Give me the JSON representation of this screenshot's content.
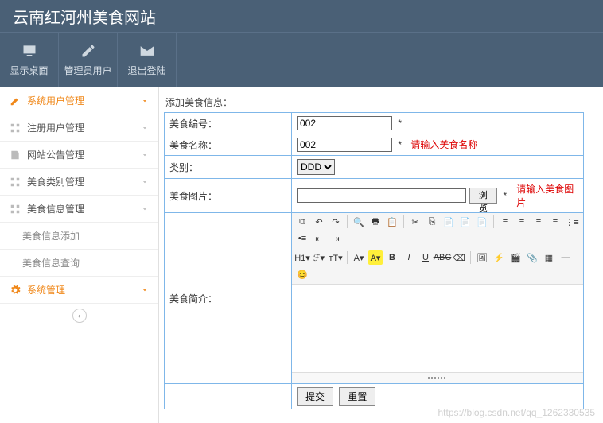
{
  "header": {
    "title": "云南红河州美食网站"
  },
  "toolbar": {
    "desktop": "显示桌面",
    "admin": "管理员用户",
    "logout": "退出登陆"
  },
  "sidebar": {
    "sys_user": "系统用户管理",
    "reg_user": "注册用户管理",
    "notice": "网站公告管理",
    "food_cat": "美食类别管理",
    "food_info": "美食信息管理",
    "food_add": "美食信息添加",
    "food_query": "美食信息查询",
    "sys_mgr": "系统管理"
  },
  "main": {
    "title": "添加美食信息：",
    "rows": {
      "id": {
        "label": "美食编号：",
        "value": "002",
        "star": "*"
      },
      "name": {
        "label": "美食名称：",
        "value": "002",
        "star": "*",
        "err": "请输入美食名称"
      },
      "cat": {
        "label": "类别：",
        "selected": "DDD"
      },
      "pic": {
        "label": "美食图片：",
        "browse": "浏览",
        "star": "*",
        "err": "请输入美食图片"
      },
      "intro": {
        "label": "美食简介："
      }
    },
    "buttons": {
      "submit": "提交",
      "reset": "重置"
    }
  },
  "watermark": "https://blog.csdn.net/qq_1262330535"
}
